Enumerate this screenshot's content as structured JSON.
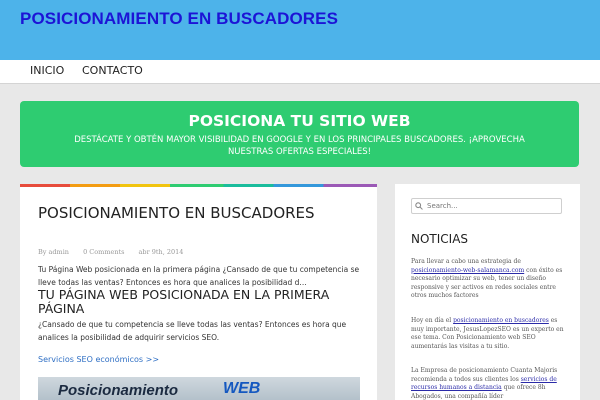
{
  "site": {
    "title": "POSICIONAMIENTO EN BUSCADORES"
  },
  "nav": {
    "items": [
      {
        "label": "INICIO"
      },
      {
        "label": "CONTACTO"
      }
    ]
  },
  "banner": {
    "title": "POSICIONA TU SITIO WEB",
    "subtitle": "DESTÁCATE Y OBTÉN MAYOR VISIBILIDAD EN GOOGLE Y EN LOS PRINCIPALES BUSCADORES. ¡APROVECHA NUESTRAS OFERTAS ESPECIALES!"
  },
  "post": {
    "title": "POSICIONAMIENTO EN BUSCADORES",
    "author": "By admin",
    "comments": "0 Comments",
    "date": "abr 9th, 2014",
    "excerpt": "Tu Página Web posicionada en la primera página ¿Cansado de que tu competencia se lleve todas las ventas? Entonces es hora que analices la posibilidad d...",
    "heading": "TU PÁGINA WEB POSICIONADA EN LA PRIMERA PÁGINA",
    "body": "¿Cansado de que tu competencia se lleve todas las ventas? Entonces es hora que analices la posibilidad de adquirir servicios SEO.",
    "link_text": "Servicios SEO económicos >>",
    "image_word": "Posicionamiento",
    "image_word2": "WEB"
  },
  "sidebar": {
    "search_placeholder": "Search...",
    "widget_title": "NOTICIAS",
    "news": [
      {
        "pre": "Para llevar a cabo una estrategia de ",
        "link": "posicionamiento-web-salamanca.com",
        "post": " con éxito es necesario optimizar su web, tener un diseño responsive y ser activos en redes sociales entre otros muchos factores"
      },
      {
        "pre": "Hoy en día el ",
        "link": "posicionamiento en buscadores",
        "post": " es muy importante, JesusLopezSEO es un experto en ese tema. Con Posicionamiento web SEO aumentarás las visitas a tu sitio."
      },
      {
        "pre": "La Empresa de posicionamiento Cuanta Majoris recomienda a todos sus clientes los ",
        "link": "servicios de recursos humanos a distancia",
        "post": " que ofrece 8h Abogados, una compañía líder"
      }
    ]
  },
  "colors": {
    "header_bg": "#4db3ea",
    "title_color": "#1c14d6",
    "banner_bg": "#2ecc71",
    "link_color": "#2f6fc4"
  }
}
